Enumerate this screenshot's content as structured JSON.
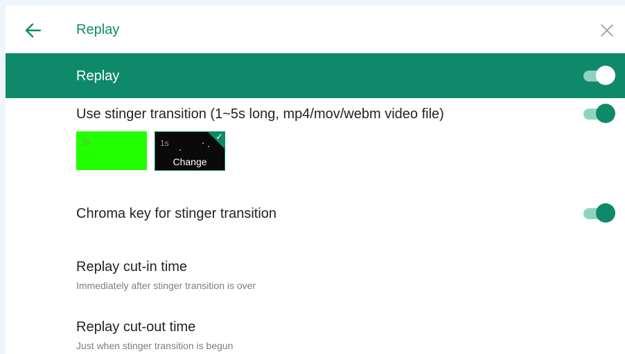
{
  "header": {
    "title": "Replay",
    "back_icon": "arrow-left-icon",
    "close_icon": "close-icon"
  },
  "section": {
    "title": "Replay",
    "toggle_on": true
  },
  "stinger": {
    "label": "Use stinger transition (1~5s long, mp4/mov/webm video file)",
    "toggle_on": true,
    "thumbnails": [
      {
        "duration": "2s",
        "color": "#22ff00"
      },
      {
        "duration": "1s",
        "action": "Change",
        "selected": true
      }
    ]
  },
  "chroma": {
    "label": "Chroma key for stinger transition",
    "toggle_on": true
  },
  "cut_in": {
    "label": "Replay cut-in time",
    "value": "Immediately after stinger transition is over"
  },
  "cut_out": {
    "label": "Replay cut-out time",
    "value": "Just when stinger transition is begun"
  },
  "colors": {
    "accent": "#0e8a6a",
    "background": "#eef5fb"
  }
}
